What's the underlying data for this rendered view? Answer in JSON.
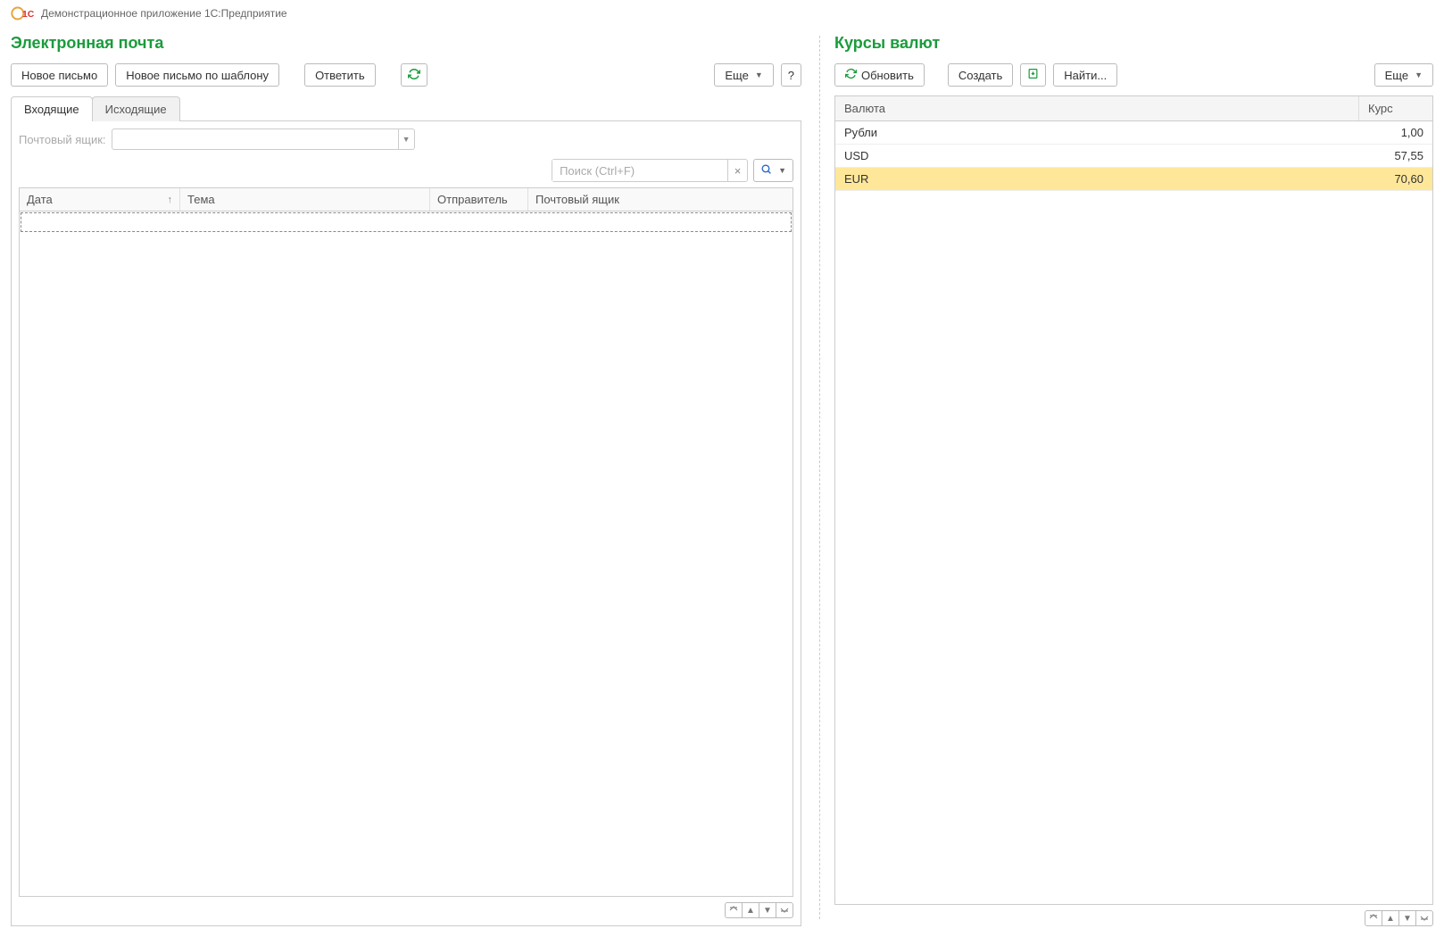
{
  "header": {
    "app_title": "Демонстрационное приложение 1С:Предприятие"
  },
  "email": {
    "title": "Электронная почта",
    "buttons": {
      "new_letter": "Новое письмо",
      "new_template": "Новое письмо по шаблону",
      "reply": "Ответить",
      "more": "Еще",
      "help": "?"
    },
    "tabs": {
      "inbox": "Входящие",
      "outbox": "Исходящие"
    },
    "mailbox_label": "Почтовый ящик:",
    "search_placeholder": "Поиск (Ctrl+F)",
    "columns": {
      "date": "Дата",
      "subject": "Тема",
      "sender": "Отправитель",
      "mailbox": "Почтовый ящик"
    }
  },
  "rates": {
    "title": "Курсы валют",
    "buttons": {
      "refresh": "Обновить",
      "create": "Создать",
      "find": "Найти...",
      "more": "Еще"
    },
    "columns": {
      "currency": "Валюта",
      "rate": "Курс"
    },
    "rows": [
      {
        "currency": "Рубли",
        "rate": "1,00",
        "highlight": false
      },
      {
        "currency": "USD",
        "rate": "57,55",
        "highlight": false
      },
      {
        "currency": "EUR",
        "rate": "70,60",
        "highlight": true
      }
    ]
  }
}
